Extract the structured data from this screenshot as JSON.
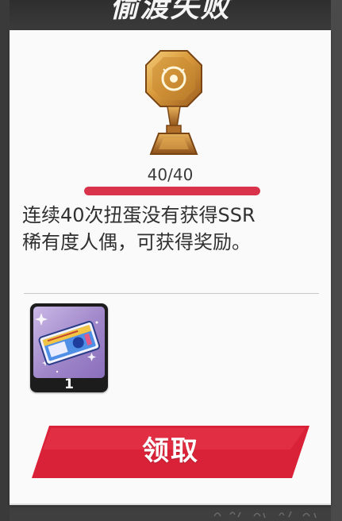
{
  "header": {
    "title": "偷渡失败"
  },
  "progress": {
    "text": "40/40",
    "current": 40,
    "total": 40,
    "fill_fraction": 1.0,
    "fill_color": "#d8334a"
  },
  "description": {
    "line1": "连续40次扭蛋没有获得SSR",
    "line2": "稀有度人偶，可获得奖励。"
  },
  "reward": {
    "icon": "ticket-icon",
    "quantity": "1"
  },
  "claim_button": {
    "label": "领取",
    "color": "#e0283d"
  },
  "colors": {
    "panel": "#fafafa",
    "header": "#333333",
    "trophy_gold": "#d99a3c"
  }
}
